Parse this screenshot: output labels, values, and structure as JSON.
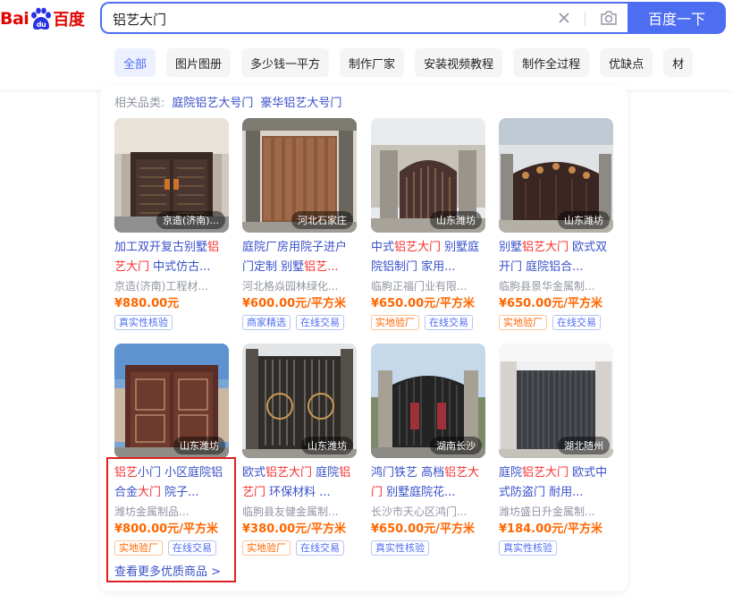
{
  "logo": {
    "bai": "Bai",
    "du": "du",
    "cn": "百度"
  },
  "search": {
    "query": "铝艺大门",
    "button_label": "百度一下"
  },
  "filters": [
    "全部",
    "图片图册",
    "多少钱一平方",
    "制作厂家",
    "安装视频教程",
    "制作全过程",
    "优缺点",
    "材"
  ],
  "related": {
    "label": "相关品类:",
    "items": [
      "庭院铝艺大号门",
      "豪华铝艺大号门"
    ]
  },
  "products": [
    {
      "title_parts": [
        "加工双开复古别墅",
        "铝",
        "\n",
        "艺大门",
        " 中式仿古..."
      ],
      "location": "京造(济南)...",
      "seller": "京造(济南)工程材...",
      "price": "¥880.00元",
      "tags": [
        "真实性核验"
      ]
    },
    {
      "title_parts": [
        "庭院厂房用院子进户门定制 别墅",
        "铝艺..."
      ],
      "location": "河北石家庄",
      "seller": "河北格焱园林绿化...",
      "price": "¥600.00元/平方米",
      "tags": [
        "商家精选",
        "在线交易"
      ]
    },
    {
      "title_parts": [
        "中式",
        "铝艺大门",
        " 别墅庭院铝制门 家用..."
      ],
      "location": "山东潍坊",
      "seller": "临朐正福门业有限...",
      "price": "¥650.00元/平方米",
      "tags": [
        "实地验厂",
        "在线交易"
      ]
    },
    {
      "title_parts": [
        "别墅",
        "铝艺大门",
        " 欧式双开门 庭院铝合..."
      ],
      "location": "山东潍坊",
      "seller": "临朐县景华金属制...",
      "price": "¥650.00元/平方米",
      "tags": [
        "实地验厂",
        "在线交易"
      ]
    },
    {
      "title_parts": [
        "铝艺",
        "小门 小区庭院铝合金",
        "大门",
        " 院子..."
      ],
      "location": "山东潍坊",
      "seller": "潍坊金属制品...",
      "price": "¥800.00元/平方米",
      "tags": [
        "实地验厂",
        "在线交易"
      ]
    },
    {
      "title_parts": [
        "欧式",
        "铝艺大门",
        " 庭院",
        "铝艺门",
        " 环保材料 ..."
      ],
      "location": "山东潍坊",
      "seller": "临朐县友健金属制...",
      "price": "¥380.00元/平方米",
      "tags": [
        "实地验厂",
        "在线交易"
      ]
    },
    {
      "title_parts": [
        "鸿门铁艺 高档",
        "铝艺大门",
        " 别墅庭院花..."
      ],
      "location": "湖南长沙",
      "seller": "长沙市天心区鸿门...",
      "price": "¥650.00元/平方米",
      "tags": [
        "真实性核验"
      ]
    },
    {
      "title_parts": [
        "庭院",
        "铝艺大门",
        " 欧式中式防盗门 耐用..."
      ],
      "location": "湖北随州",
      "seller": "潍坊盛日升金属制...",
      "price": "¥184.00元/平方米",
      "tags": [
        "真实性核验"
      ]
    }
  ],
  "more_link": "查看更多优质商品 >",
  "colors": {
    "accent": "#4e6ef2",
    "link": "#3951c9",
    "highlight": "#f73131",
    "price": "#ff6600",
    "annotation": "#e02020"
  }
}
